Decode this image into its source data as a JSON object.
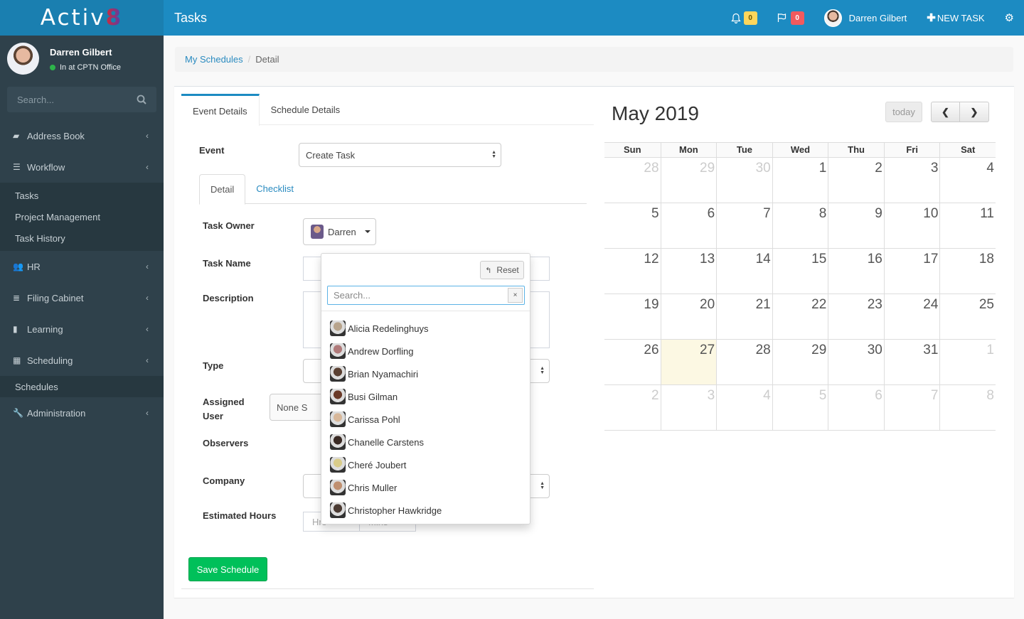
{
  "app": {
    "logo_text": "Activ",
    "logo_accent": "8",
    "page_title": "Tasks"
  },
  "topbar": {
    "notifications_count": "0",
    "flags_count": "0",
    "user_name": "Darren Gilbert",
    "new_task_label": "NEW TASK",
    "colors": {
      "bar": "#1c8bc2",
      "notif_badge": "#fcd65c",
      "flag_badge": "#f15a5e"
    }
  },
  "sidebar": {
    "user_name": "Darren Gilbert",
    "user_status": "In at CPTN Office",
    "search_placeholder": "Search...",
    "items": [
      {
        "label": "Address Book",
        "icon": "book-icon"
      },
      {
        "label": "Workflow",
        "icon": "list-icon"
      },
      {
        "label": "HR",
        "icon": "users-icon"
      },
      {
        "label": "Filing Cabinet",
        "icon": "database-icon"
      },
      {
        "label": "Learning",
        "icon": "bookmark-icon"
      },
      {
        "label": "Scheduling",
        "icon": "calendar-icon"
      },
      {
        "label": "Administration",
        "icon": "wrench-icon"
      }
    ],
    "workflow_sub": [
      "Tasks",
      "Project Management",
      "Task History"
    ],
    "scheduling_sub": [
      "Schedules"
    ]
  },
  "breadcrumb": {
    "parent": "My Schedules",
    "current": "Detail"
  },
  "tabs": {
    "event_details": "Event Details",
    "schedule_details": "Schedule Details"
  },
  "form": {
    "event_label": "Event",
    "event_value": "Create Task",
    "inner_tabs": {
      "detail": "Detail",
      "checklist": "Checklist"
    },
    "task_owner_label": "Task Owner",
    "task_owner_value": "Darren",
    "task_name_label": "Task Name",
    "description_label": "Description",
    "type_label": "Type",
    "assigned_user_label_1": "Assigned",
    "assigned_user_label_2": "User",
    "assigned_user_value": "None S",
    "observers_label": "Observers",
    "company_label": "Company",
    "estimated_hours_label": "Estimated Hours",
    "hrs_placeholder": "Hrs",
    "mins_placeholder": "Mins",
    "save_label": "Save Schedule"
  },
  "owner_dropdown": {
    "reset_label": "Reset",
    "search_placeholder": "Search...",
    "clear_label": "×",
    "people": [
      {
        "name": "Alicia Redelinghuys",
        "avatar_color": "#b8a48c"
      },
      {
        "name": "Andrew Dorfling",
        "avatar_color": "#b07a7a"
      },
      {
        "name": "Brian Nyamachiri",
        "avatar_color": "#5a4032"
      },
      {
        "name": "Busi Gilman",
        "avatar_color": "#6a3a28"
      },
      {
        "name": "Carissa Pohl",
        "avatar_color": "#d8b89a"
      },
      {
        "name": "Chanelle Carstens",
        "avatar_color": "#3a2a24"
      },
      {
        "name": "Cheré Joubert",
        "avatar_color": "#d9cc8a"
      },
      {
        "name": "Chris Muller",
        "avatar_color": "#c09070"
      },
      {
        "name": "Christopher Hawkridge",
        "avatar_color": "#4a3a32"
      }
    ]
  },
  "calendar": {
    "title": "May 2019",
    "today_label": "today",
    "prev_label": "<",
    "next_label": ">",
    "weekdays": [
      "Sun",
      "Mon",
      "Tue",
      "Wed",
      "Thu",
      "Fri",
      "Sat"
    ],
    "weeks": [
      [
        {
          "d": "28",
          "o": true
        },
        {
          "d": "29",
          "o": true
        },
        {
          "d": "30",
          "o": true
        },
        {
          "d": "1"
        },
        {
          "d": "2"
        },
        {
          "d": "3"
        },
        {
          "d": "4"
        }
      ],
      [
        {
          "d": "5"
        },
        {
          "d": "6"
        },
        {
          "d": "7"
        },
        {
          "d": "8"
        },
        {
          "d": "9"
        },
        {
          "d": "10"
        },
        {
          "d": "11"
        }
      ],
      [
        {
          "d": "12"
        },
        {
          "d": "13"
        },
        {
          "d": "14"
        },
        {
          "d": "15"
        },
        {
          "d": "16"
        },
        {
          "d": "17"
        },
        {
          "d": "18"
        }
      ],
      [
        {
          "d": "19"
        },
        {
          "d": "20"
        },
        {
          "d": "21"
        },
        {
          "d": "22"
        },
        {
          "d": "23"
        },
        {
          "d": "24"
        },
        {
          "d": "25"
        }
      ],
      [
        {
          "d": "26"
        },
        {
          "d": "27",
          "t": true
        },
        {
          "d": "28"
        },
        {
          "d": "29"
        },
        {
          "d": "30"
        },
        {
          "d": "31"
        },
        {
          "d": "1",
          "o": true
        }
      ],
      [
        {
          "d": "2",
          "o": true
        },
        {
          "d": "3",
          "o": true
        },
        {
          "d": "4",
          "o": true
        },
        {
          "d": "5",
          "o": true
        },
        {
          "d": "6",
          "o": true
        },
        {
          "d": "7",
          "o": true
        },
        {
          "d": "8",
          "o": true
        }
      ]
    ],
    "today_date": "27",
    "today_color": "#fcf8e3"
  }
}
